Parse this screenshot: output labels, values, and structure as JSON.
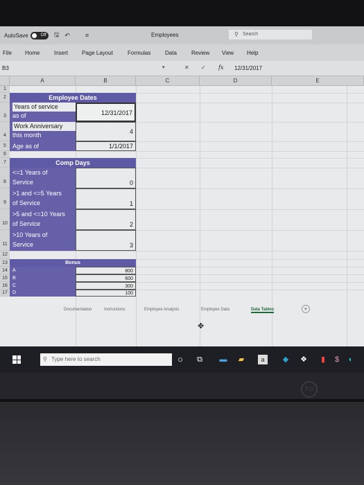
{
  "titlebar": {
    "autosave_label": "AutoSave",
    "autosave_state": "Off",
    "document_title": "Employees",
    "search_label": "Search"
  },
  "ribbon": {
    "tabs": [
      "File",
      "Home",
      "Insert",
      "Page Layout",
      "Formulas",
      "Data",
      "Review",
      "View",
      "Help"
    ]
  },
  "formula_bar": {
    "name_box": "B3",
    "fx": "fx",
    "value": "12/31/2017"
  },
  "columns": [
    "A",
    "B",
    "C",
    "D",
    "E"
  ],
  "rows": [
    "1",
    "2",
    "3",
    "4",
    "5",
    "6",
    "7",
    "8",
    "9",
    "10",
    "11",
    "12",
    "13",
    "14",
    "15",
    "16",
    "17"
  ],
  "employee_dates": {
    "header": "Employee Dates",
    "years_label_1": "Years of service",
    "years_label_2": "as of",
    "years_value": "12/31/2017",
    "anniv_label_1": "Work Anniversary",
    "anniv_label_2": "this month",
    "anniv_value": "4",
    "age_label": "Age as of",
    "age_value": "1/1/2017"
  },
  "comp_days": {
    "header": "Comp Days",
    "rows": [
      {
        "label_1": "<=1 Years of",
        "label_2": "Service",
        "value": "0"
      },
      {
        "label_1": ">1 and <=5 Years",
        "label_2": "of Service",
        "value": "1"
      },
      {
        "label_1": ">5 and <=10 Years",
        "label_2": "of Service",
        "value": "2"
      },
      {
        "label_1": ">10 Years of",
        "label_2": "Service",
        "value": "3"
      }
    ]
  },
  "bonus": {
    "header": "Bonus",
    "rows": [
      {
        "grade": "A",
        "value": "800"
      },
      {
        "grade": "B",
        "value": "600"
      },
      {
        "grade": "C",
        "value": "300"
      },
      {
        "grade": "D",
        "value": "100"
      }
    ]
  },
  "sheet_tabs": [
    "Documentation",
    "Instructions",
    "Employee Analysis",
    "Employee Data",
    "Data Tables"
  ],
  "active_sheet": "Data Tables",
  "taskbar": {
    "search_placeholder": "Type here to search"
  },
  "colors": {
    "accent_purple": "#5f5aa6",
    "excel_green": "#1e6b3a"
  }
}
